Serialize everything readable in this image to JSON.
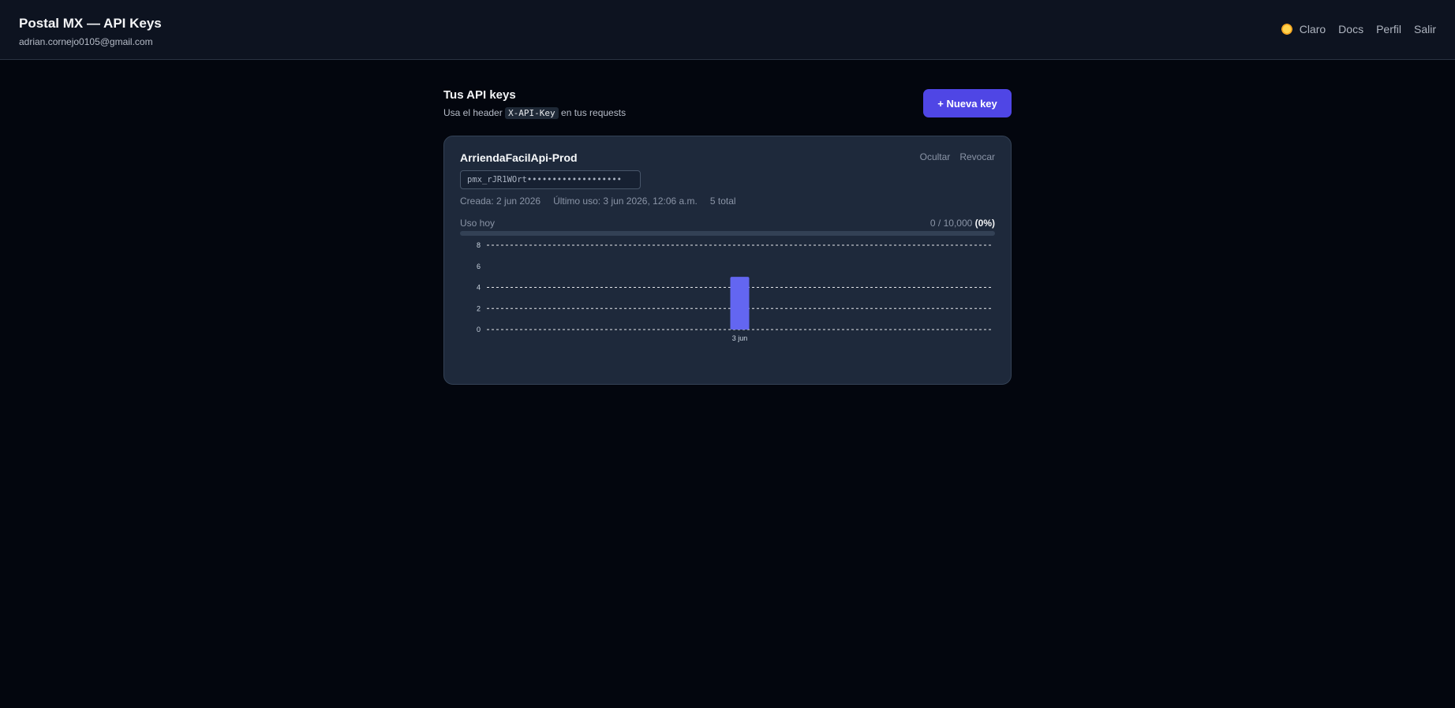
{
  "header": {
    "title": "Postal MX — API Keys",
    "email": "adrian.cornejo0105@gmail.com",
    "nav": {
      "theme_icon": "sun-icon",
      "theme_label": "Claro",
      "docs": "Docs",
      "profile": "Perfil",
      "logout": "Salir"
    }
  },
  "section": {
    "title": "Tus API keys",
    "subtitle_before": "Usa el header",
    "subtitle_code": "X-API-Key",
    "subtitle_after": "en tus requests",
    "new_key_button": "+ Nueva key"
  },
  "key": {
    "name": "ArriendaFacilApi-Prod",
    "hide": "Ocultar",
    "revoke": "Revocar",
    "masked_value": "pmx_rJR1WOrt•••••••••••••••••••",
    "created": "Creada: 2 jun 2026",
    "last_used": "Último uso: 3 jun 2026, 12:06 a.m.",
    "total": "5 total",
    "usage_label": "Uso hoy",
    "usage_count": "0 / 10,000",
    "usage_percent": "(0%)",
    "usage_fraction": 0
  },
  "colors": {
    "accent": "#4f46e5",
    "bar": "#6366f1",
    "card": "#1e293b",
    "background": "#03060e"
  },
  "chart_data": {
    "type": "bar",
    "categories": [
      "3 jun"
    ],
    "values": [
      5
    ],
    "ylim": [
      0,
      8
    ],
    "yticks": [
      0,
      2,
      4,
      6,
      8
    ],
    "grid": true
  }
}
